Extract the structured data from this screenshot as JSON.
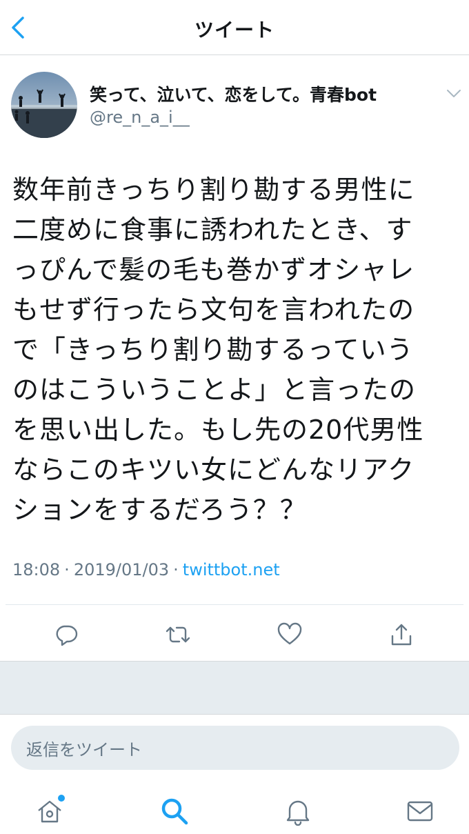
{
  "header": {
    "title": "ツイート",
    "back_icon": "chevron-left-icon"
  },
  "tweet": {
    "display_name": "笑って、泣いて、恋をして。青春bot",
    "handle": "@re_n_a_i__",
    "text": "数年前きっちり割り勘する男性に\n二度めに食事に誘われたとき、す\nっぴんで髪の毛も巻かずオシャレ\nもせず行ったら文句を言われたの\nで「きっちり割り勘するっていう\nのはこういうことよ」と言ったの\nを思い出した。もし先の20代男性\nならこのキツい女にどんなリアク\nションをするだろう？？",
    "time": "18:08",
    "date": "2019/01/03",
    "separator": "·",
    "source": "twittbot.net"
  },
  "actions": {
    "reply_icon": "reply-icon",
    "retweet_icon": "retweet-icon",
    "like_icon": "like-heart-icon",
    "share_icon": "share-icon"
  },
  "reply": {
    "placeholder": "返信をツイート"
  },
  "tabbar": {
    "home_icon": "home-icon",
    "search_icon": "search-icon",
    "notifications_icon": "bell-icon",
    "messages_icon": "envelope-icon"
  },
  "colors": {
    "accent": "#1da1f2",
    "text": "#14171a",
    "secondary": "#657786",
    "band": "#e6ecf0"
  }
}
